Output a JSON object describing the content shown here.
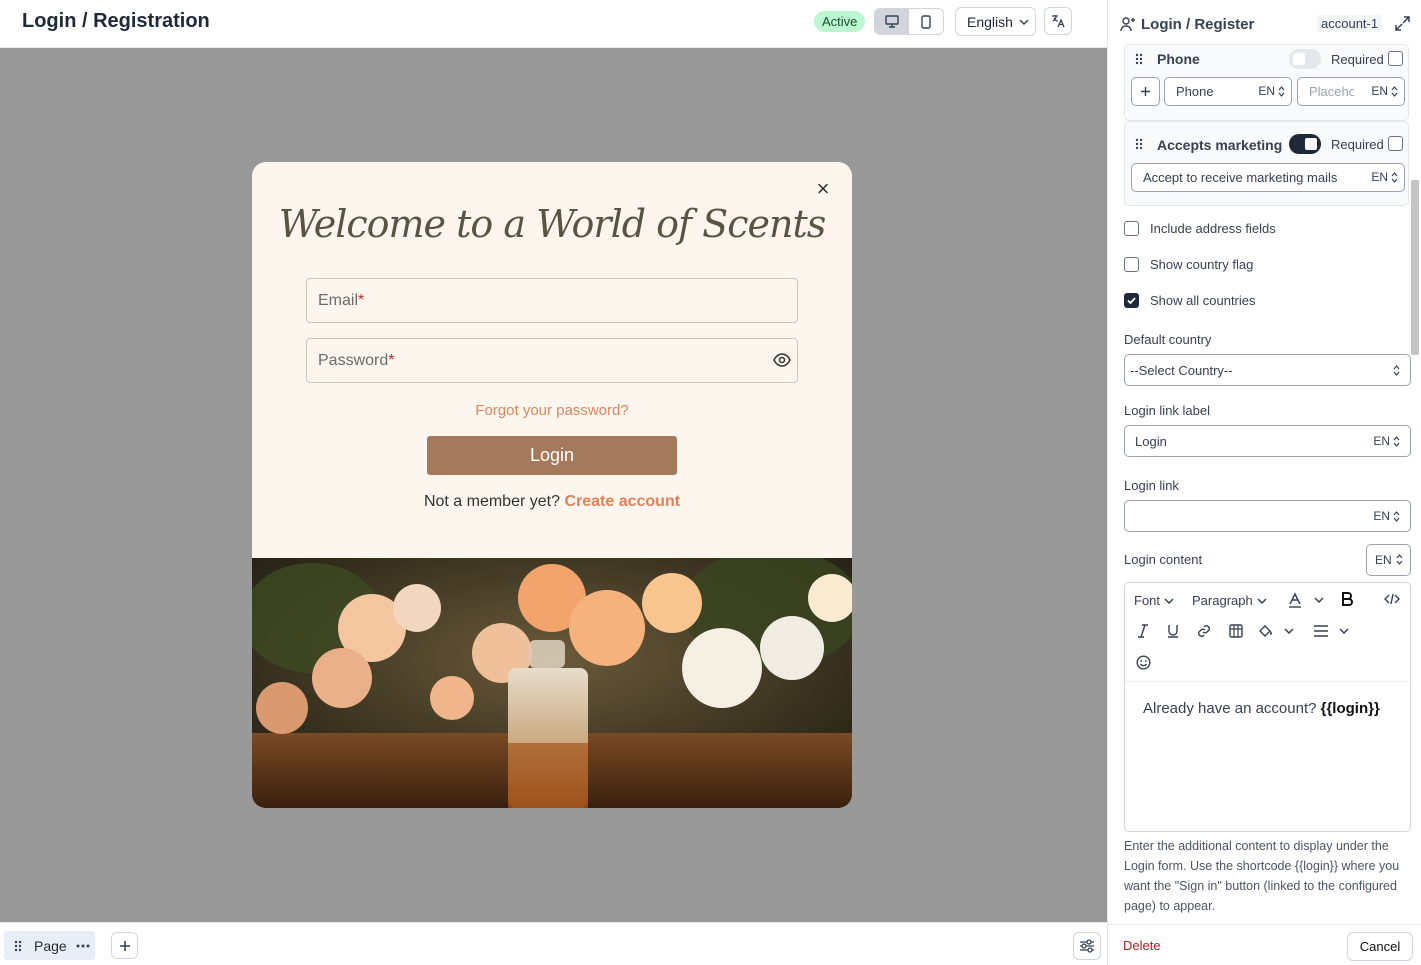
{
  "header": {
    "title": "Login / Registration",
    "status": "Active",
    "language": "English"
  },
  "modal": {
    "heading": "Welcome to a World of Scents",
    "email_placeholder": "Email",
    "password_placeholder": "Password",
    "required_mark": "*",
    "forgot_link": "Forgot your password?",
    "login_button": "Login",
    "member_text": "Not a member yet?",
    "create_link": "Create account"
  },
  "panel": {
    "title": "Login / Register",
    "account_tag": "account-1",
    "phone": {
      "label": "Phone",
      "required_label": "Required",
      "enabled": false,
      "required": false,
      "label_value": "Phone",
      "placeholder_value": "Placeho",
      "lang": "EN"
    },
    "marketing": {
      "label": "Accepts marketing",
      "required_label": "Required",
      "enabled": true,
      "required": false,
      "text_value": "Accept to receive marketing mails",
      "lang": "EN"
    },
    "options": [
      {
        "label": "Include address fields",
        "checked": false
      },
      {
        "label": "Show country flag",
        "checked": false
      },
      {
        "label": "Show all countries",
        "checked": true
      }
    ],
    "default_country_label": "Default country",
    "default_country_value": "--Select Country--",
    "login_link_label_label": "Login link label",
    "login_link_label_value": "Login",
    "login_link_label": "Login link",
    "login_link_value": "",
    "login_content_label": "Login content",
    "lang": "EN",
    "editor": {
      "font_label": "Font",
      "paragraph_label": "Paragraph",
      "content_text": "Already have an account?",
      "content_code": "{{login}}"
    },
    "help_text": "Enter the additional content to display under the Login form. Use the shortcode {{login}} where you want the \"Sign in\" button (linked to the configured page) to appear.",
    "delete_label": "Delete",
    "cancel_label": "Cancel"
  },
  "footer": {
    "page_tab": "Page"
  }
}
